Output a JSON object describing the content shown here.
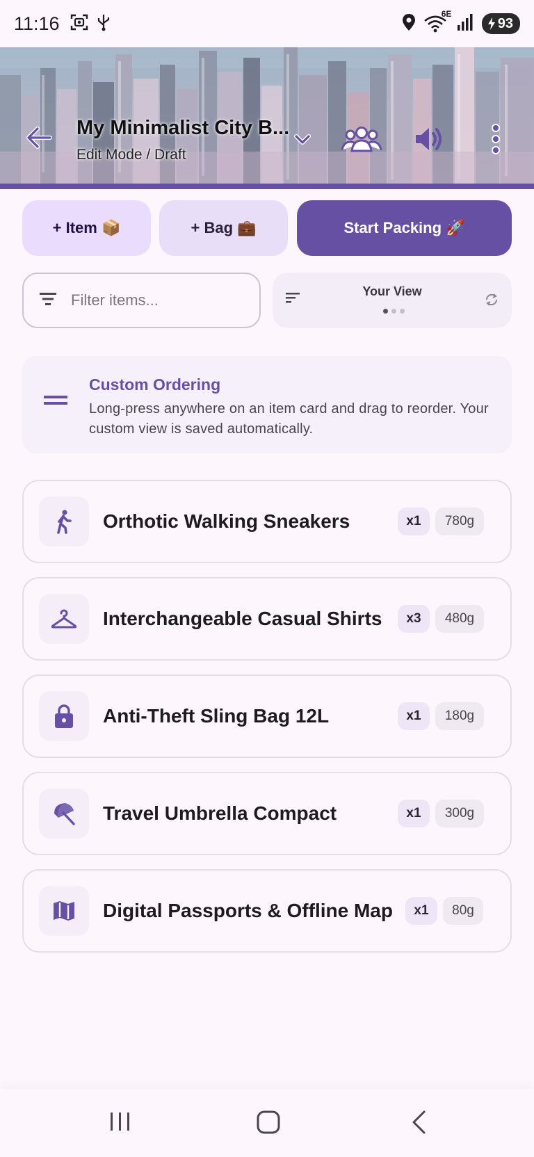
{
  "status_bar": {
    "time": "11:16",
    "network": "6E",
    "battery": "93"
  },
  "header": {
    "title": "My Minimalist City B...",
    "subtitle": "Edit Mode / Draft"
  },
  "actions": {
    "add_item": "+ Item 📦",
    "add_bag": "+ Bag 💼",
    "start_packing": "Start Packing 🚀"
  },
  "filter": {
    "placeholder": "Filter items...",
    "value": ""
  },
  "view": {
    "label": "Your View",
    "page_count": 3,
    "active_page": 1
  },
  "info": {
    "title": "Custom Ordering",
    "text": "Long-press anywhere on an item card and drag to reorder. Your custom view is saved automatically."
  },
  "items": [
    {
      "name": "Orthotic Walking Sneakers",
      "qty": "x1",
      "weight": "780g",
      "icon": "walking-person-icon"
    },
    {
      "name": "Interchangeable Casual Shirts",
      "qty": "x3",
      "weight": "480g",
      "icon": "hanger-icon"
    },
    {
      "name": "Anti-Theft Sling Bag 12L",
      "qty": "x1",
      "weight": "180g",
      "icon": "lock-icon"
    },
    {
      "name": "Travel Umbrella Compact",
      "qty": "x1",
      "weight": "300g",
      "icon": "umbrella-icon"
    },
    {
      "name": "Digital Passports & Offline Map",
      "qty": "x1",
      "weight": "80g",
      "icon": "map-icon"
    }
  ],
  "colors": {
    "primary": "#6650a4",
    "background": "#fdf7fd",
    "tonal": "#eadcfc"
  }
}
